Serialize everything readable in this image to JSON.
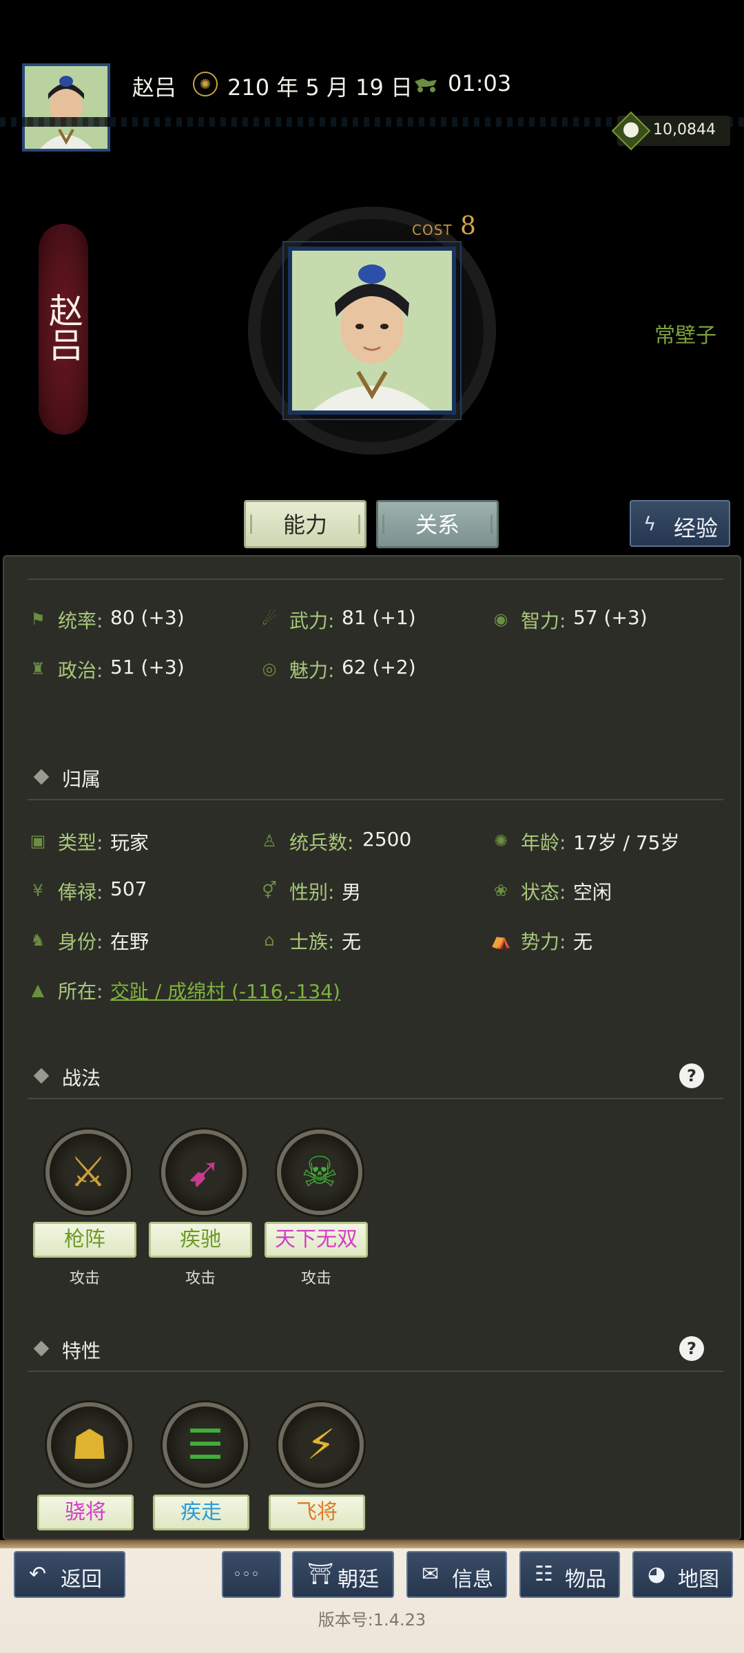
{
  "header": {
    "character_name": "赵吕",
    "date": "210 年 5 月 19 日",
    "time": "01:03",
    "gold": "10,0844"
  },
  "hero": {
    "banner_name": "赵吕",
    "cost_label": "COST",
    "cost_value": "8",
    "nickname": "常壁子"
  },
  "tabs": {
    "ability": "能力",
    "relation": "关系",
    "exp_label": "经验"
  },
  "stats": [
    {
      "label": "统率:",
      "value": "80 (+3)"
    },
    {
      "label": "武力:",
      "value": "81 (+1)"
    },
    {
      "label": "智力:",
      "value": "57 (+3)"
    },
    {
      "label": "政治:",
      "value": "51 (+3)"
    },
    {
      "label": "魅力:",
      "value": "62 (+2)"
    }
  ],
  "affiliation": {
    "title": "归属",
    "items": [
      {
        "label": "类型:",
        "value": "玩家"
      },
      {
        "label": "统兵数:",
        "value": "2500"
      },
      {
        "label": "年龄:",
        "value": "17岁 / 75岁"
      },
      {
        "label": "俸禄:",
        "value": "507"
      },
      {
        "label": "性别:",
        "value": "男"
      },
      {
        "label": "状态:",
        "value": "空闲"
      },
      {
        "label": "身份:",
        "value": "在野"
      },
      {
        "label": "士族:",
        "value": "无"
      },
      {
        "label": "势力:",
        "value": "无"
      }
    ],
    "location_label": "所在:",
    "location_value": "交趾 / 成绵村 (-116,-134)"
  },
  "tactics": {
    "title": "战法",
    "help": "?",
    "items": [
      {
        "name": "枪阵",
        "type": "攻击",
        "color": "#6d9a28"
      },
      {
        "name": "疾驰",
        "type": "攻击",
        "color": "#6d9a28"
      },
      {
        "name": "天下无双",
        "type": "攻击",
        "color": "#d43cc8"
      }
    ]
  },
  "traits": {
    "title": "特性",
    "help": "?",
    "items": [
      {
        "name": "骁将",
        "color": "#d43cc8"
      },
      {
        "name": "疾走",
        "color": "#2a9bd8"
      },
      {
        "name": "飞将",
        "color": "#e07a24"
      }
    ]
  },
  "nav": {
    "back": "返回",
    "more": "◦◦◦",
    "court": "朝廷",
    "info": "信息",
    "items": "物品",
    "map": "地图"
  },
  "version": "版本号:1.4.23"
}
